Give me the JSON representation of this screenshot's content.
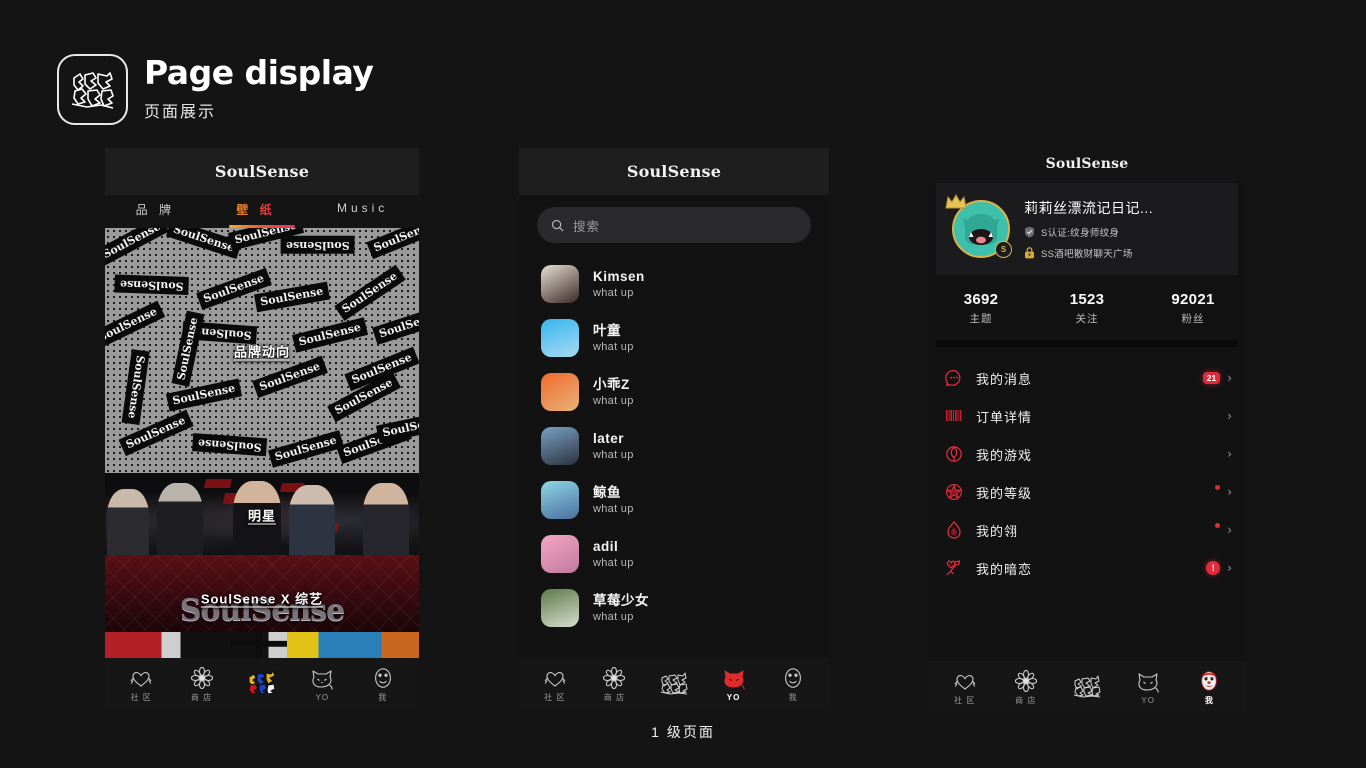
{
  "header": {
    "title": "Page display",
    "subtitle": "页面展示",
    "logo_icon": "soulsense-gothic-logo-icon"
  },
  "caption": "1 级页面",
  "brand": "SoulSense",
  "phone1": {
    "brandmark": "SoulSense",
    "tabs": [
      {
        "label": "品 牌",
        "active": false
      },
      {
        "label": "壁 纸",
        "active": true
      },
      {
        "label": "Music",
        "active": false
      }
    ],
    "cards": [
      {
        "label": "品牌动向",
        "kind": "wallpaper-sticker-pattern",
        "sticker_text": "SoulSense"
      },
      {
        "label": "SoulSense X 综艺",
        "kind": "star-banner",
        "overlay_label": "明星",
        "big_text": "SoulSense"
      }
    ],
    "nav": [
      {
        "label": "社 区",
        "icon": "heart-wings-icon",
        "active": false
      },
      {
        "label": "商 店",
        "icon": "flower-icon",
        "active": false
      },
      {
        "label": "",
        "icon": "soulsense-color-logo-icon",
        "active": true
      },
      {
        "label": "YO",
        "icon": "devil-cat-icon",
        "active": false
      },
      {
        "label": "我",
        "icon": "clown-mask-icon",
        "active": false
      }
    ]
  },
  "phone2": {
    "brandmark": "SoulSense",
    "search": {
      "placeholder": "搜索",
      "value": "",
      "icon": "search-icon"
    },
    "chats": [
      {
        "name": "Kimsen",
        "message": "what up",
        "avatar": "avatar-kimsen"
      },
      {
        "name": "叶童",
        "message": "what up",
        "avatar": "avatar-yetong"
      },
      {
        "name": "小乖Z",
        "message": "what up",
        "avatar": "avatar-xiaoguaiz"
      },
      {
        "name": "later",
        "message": "what up",
        "avatar": "avatar-later"
      },
      {
        "name": "鲸鱼",
        "message": "what up",
        "avatar": "avatar-jingyu"
      },
      {
        "name": "adil",
        "message": "what up",
        "avatar": "avatar-adil"
      },
      {
        "name": "草莓少女",
        "message": "what up",
        "avatar": "avatar-caomeishaonv"
      }
    ],
    "nav": [
      {
        "label": "社 区",
        "icon": "heart-wings-icon",
        "active": false
      },
      {
        "label": "商 店",
        "icon": "flower-icon",
        "active": false
      },
      {
        "label": "",
        "icon": "soulsense-gothic-logo-icon",
        "active": false
      },
      {
        "label": "YO",
        "icon": "devil-cat-icon",
        "active": true
      },
      {
        "label": "我",
        "icon": "clown-mask-icon",
        "active": false
      }
    ]
  },
  "phone3": {
    "brandmark": "SoulSense",
    "profile": {
      "name": "莉莉丝漂流记日记...",
      "avatar": "green-cat-avatar",
      "crown": "crown-icon",
      "level_badge": "S",
      "tags": [
        {
          "icon": "shield-icon",
          "text": "S认证:纹身师纹身"
        },
        {
          "icon": "lock-icon",
          "text": "SS酒吧散财聊天广场"
        }
      ]
    },
    "stats": [
      {
        "value": "3692",
        "label": "主题"
      },
      {
        "value": "1523",
        "label": "关注"
      },
      {
        "value": "92021",
        "label": "粉丝"
      }
    ],
    "menu": [
      {
        "label": "我的消息",
        "icon": "chat-bubble-icon",
        "badge": "21",
        "badge_type": "num"
      },
      {
        "label": "订单详情",
        "icon": "barcode-icon",
        "badge": "",
        "badge_type": "none"
      },
      {
        "label": "我的游戏",
        "icon": "game-target-icon",
        "badge": "",
        "badge_type": "none"
      },
      {
        "label": "我的等级",
        "icon": "star-seal-icon",
        "badge": "",
        "badge_type": "dot"
      },
      {
        "label": "我的翎",
        "icon": "flame-icon",
        "badge": "",
        "badge_type": "dot"
      },
      {
        "label": "我的暗恋",
        "icon": "cupid-icon",
        "badge": "!",
        "badge_type": "circ"
      }
    ],
    "nav": [
      {
        "label": "社 区",
        "icon": "heart-wings-icon",
        "active": false
      },
      {
        "label": "商 店",
        "icon": "flower-icon",
        "active": false
      },
      {
        "label": "",
        "icon": "soulsense-gothic-logo-icon",
        "active": false
      },
      {
        "label": "YO",
        "icon": "devil-cat-icon",
        "active": false
      },
      {
        "label": "我",
        "icon": "clown-mask-icon",
        "active": true
      }
    ]
  },
  "colors": {
    "background": "#141414",
    "panel": "#1e1e1e",
    "accent_red": "#e02b3b",
    "accent_gradient_start": "#f5b41c",
    "accent_gradient_end": "#ec2a63",
    "gold": "#d9b24a",
    "avatar_green": "#3fc0ac"
  }
}
